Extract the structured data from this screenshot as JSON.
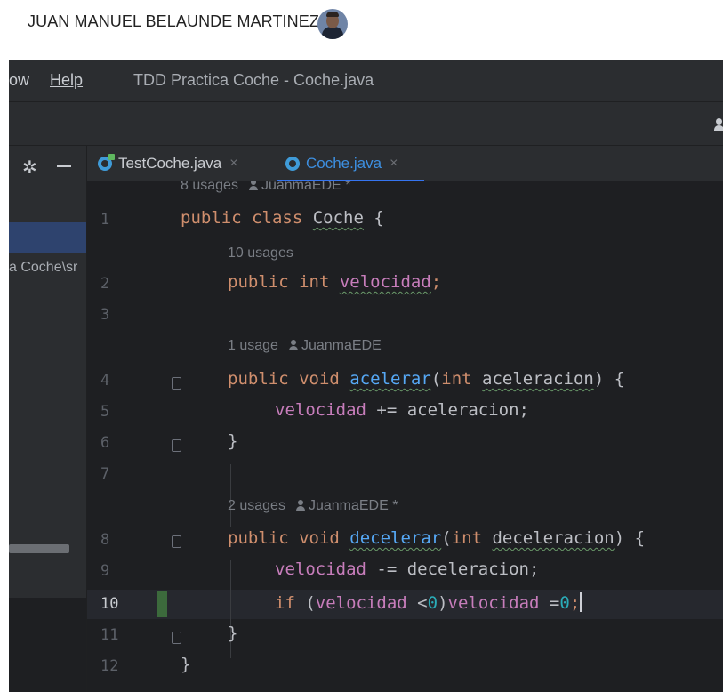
{
  "user": {
    "name": "JUAN MANUEL BELAUNDE MARTINEZ"
  },
  "menubar": {
    "items": [
      {
        "label": "ow"
      },
      {
        "label": "Help"
      }
    ],
    "window_title": "TDD Practica Coche - Coche.java"
  },
  "project": {
    "path_fragment": "a Coche\\sr"
  },
  "tabs": [
    {
      "label": "TestCoche.java",
      "close": "×"
    },
    {
      "label": "Coche.java",
      "close": "×"
    }
  ],
  "hints": {
    "class_usages": "8 usages",
    "class_author": "JuanmaEDE *",
    "field_usages": "10 usages",
    "acelerar_usages": "1 usage",
    "acelerar_author": "JuanmaEDE",
    "decelerar_usages": "2 usages",
    "decelerar_author": "JuanmaEDE *"
  },
  "line_numbers": [
    "1",
    "2",
    "3",
    "4",
    "5",
    "6",
    "7",
    "8",
    "9",
    "10",
    "11",
    "12"
  ],
  "code": {
    "l1": {
      "kw": "public class ",
      "name": "Coche",
      "rest": " {"
    },
    "l2": {
      "kw": "public int ",
      "field": "velocidad",
      "rest": ";"
    },
    "l4": {
      "kw": "public void ",
      "fn": "acelerar",
      "p1": "(",
      "kw2": "int ",
      "param": "aceleracion",
      "rest": ") {"
    },
    "l5": {
      "field": "velocidad",
      "rest": " += aceleracion;"
    },
    "l6": {
      "rest": "}"
    },
    "l8": {
      "kw": "public void ",
      "fn": "decelerar",
      "p1": "(",
      "kw2": "int ",
      "param": "deceleracion",
      "rest": ") {"
    },
    "l9": {
      "field": "velocidad",
      "rest": " -= deceleracion;"
    },
    "l10": {
      "kw": "if ",
      "p1": "(",
      "field1": "velocidad",
      "op": " <",
      "n1": "0",
      "p2": ")",
      "field2": "velocidad",
      "op2": " =",
      "n2": "0",
      "semi": ";"
    },
    "l11": {
      "rest": "}"
    },
    "l12": {
      "rest": "}"
    }
  },
  "colors": {
    "keyword": "#cf8e6d",
    "field": "#c77dbb",
    "method": "#56a8f5",
    "number": "#2aacb8",
    "active_tab": "#3d8fe0"
  }
}
